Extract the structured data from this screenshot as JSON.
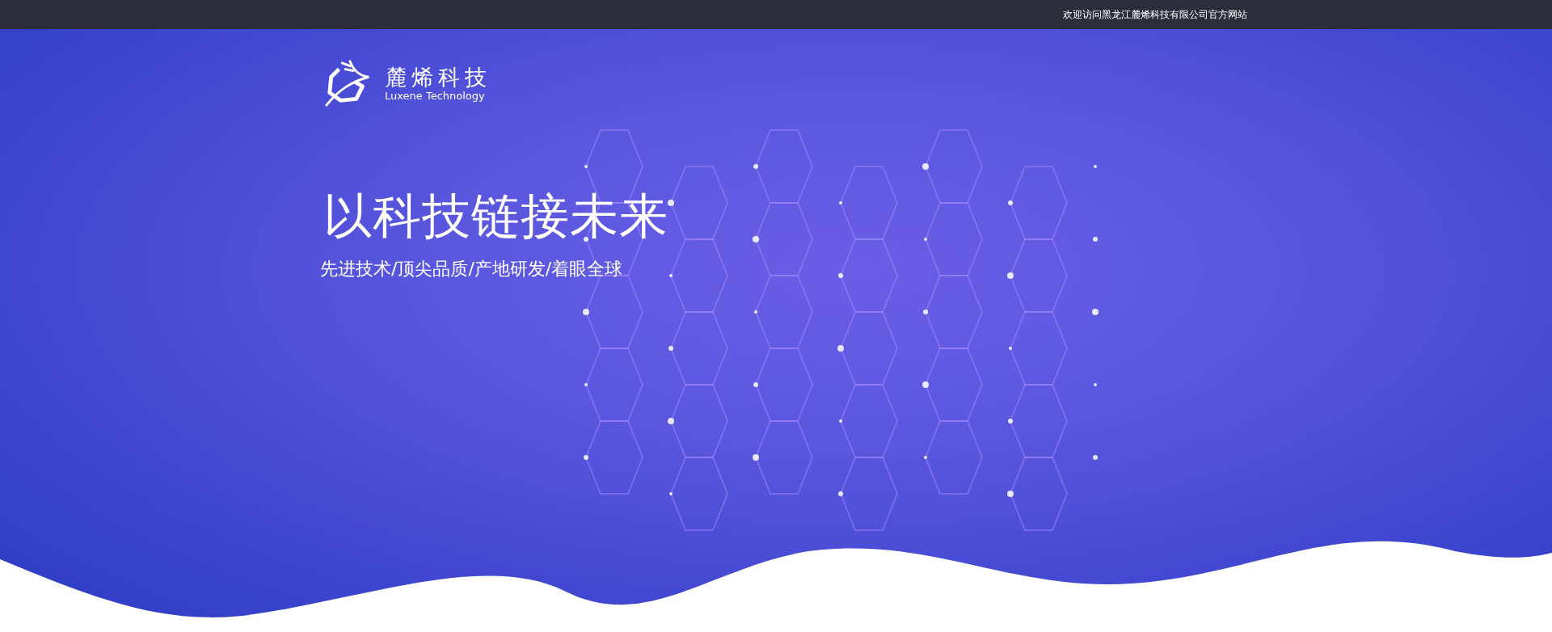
{
  "top_bar": {
    "welcome": "欢迎访问黑龙江麓烯科技有限公司官方网站"
  },
  "logo": {
    "name": "麓烯科技",
    "subtitle": "Luxene Technology"
  },
  "hero": {
    "headline": "以科技链接未来",
    "tagline": "先进技术/顶尖品质/产地研发/着眼全球"
  }
}
